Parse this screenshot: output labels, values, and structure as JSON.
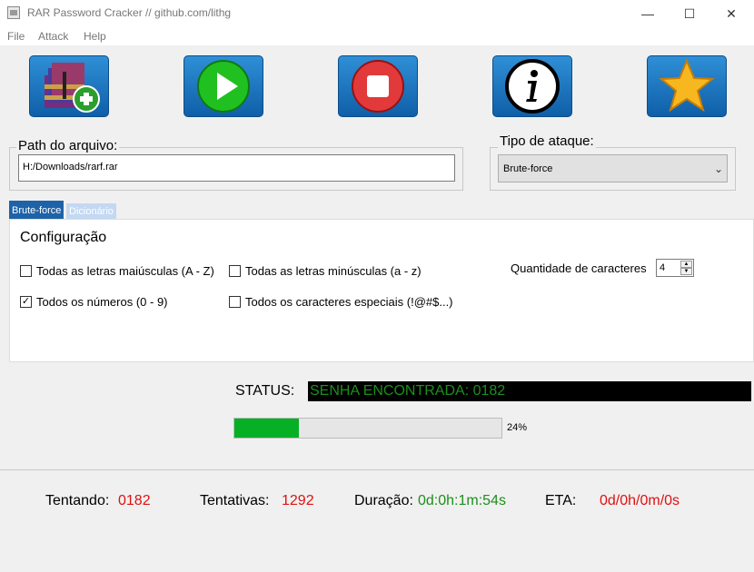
{
  "window": {
    "title": "RAR Password Cracker // github.com/lithg",
    "minimize": "—",
    "maximize": "☐",
    "close": "✕"
  },
  "menu": [
    "File",
    "Attack",
    "Help"
  ],
  "toolbar": [
    {
      "name": "open-archive-button",
      "icon": "winrar-add-icon"
    },
    {
      "name": "start-button",
      "icon": "play-icon"
    },
    {
      "name": "stop-button",
      "icon": "stop-icon"
    },
    {
      "name": "info-button",
      "icon": "info-icon"
    },
    {
      "name": "star-button",
      "icon": "star-icon"
    }
  ],
  "path": {
    "label": "Path do arquivo:",
    "value": "H:/Downloads/rarf.rar"
  },
  "attack_type": {
    "label": "Tipo de ataque:",
    "selected": "Brute-force"
  },
  "tabs": {
    "active": "Brute-force",
    "inactive": "Dicionário"
  },
  "config": {
    "title": "Configuração",
    "uppercase": {
      "label": "Todas as letras maiúsculas (A - Z)",
      "checked": false
    },
    "lowercase": {
      "label": "Todas as letras minúsculas (a - z)",
      "checked": false
    },
    "numbers": {
      "label": "Todos os números (0 - 9)",
      "checked": true
    },
    "special": {
      "label": "Todos os caracteres especiais (!@#$...)",
      "checked": false
    },
    "length_label": "Quantidade de caracteres",
    "length_value": "4"
  },
  "status": {
    "label": "STATUS:",
    "message": "SENHA ENCONTRADA: 0182",
    "message_color": "#1c8f1c"
  },
  "progress": {
    "percent": 24,
    "text": "24%"
  },
  "stats": {
    "trying_label": "Tentando:",
    "trying_value": "0182",
    "attempts_label": "Tentativas:",
    "attempts_value": "1292",
    "duration_label": "Duração:",
    "duration_value": "0d:0h:1m:54s",
    "eta_label": "ETA:",
    "eta_value": "0d/0h/0m/0s"
  },
  "colors": {
    "accent_blue": "#1a73c4",
    "red_value": "#e01010",
    "green_value": "#1c8f1c",
    "progress_fill": "#06b025"
  }
}
